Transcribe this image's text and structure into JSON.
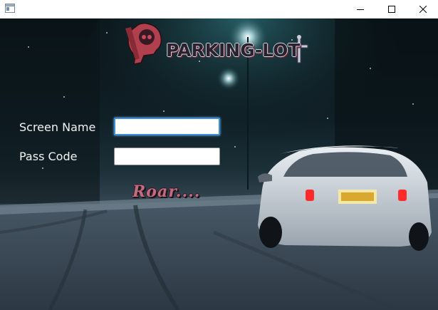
{
  "window": {
    "title": "",
    "controls": [
      "minimize-icon",
      "maximize-icon",
      "close-icon"
    ]
  },
  "logo": {
    "text": "PARKING-LOT"
  },
  "form": {
    "screen_name_label": "Screen Name",
    "screen_name_value": "",
    "pass_code_label": "Pass Code",
    "pass_code_value": "",
    "submit_label": "Roar...."
  },
  "colors": {
    "focus_border": "#3b8fd9",
    "logo_accent": "#c26a80",
    "label_text": "#f2f2f2"
  }
}
